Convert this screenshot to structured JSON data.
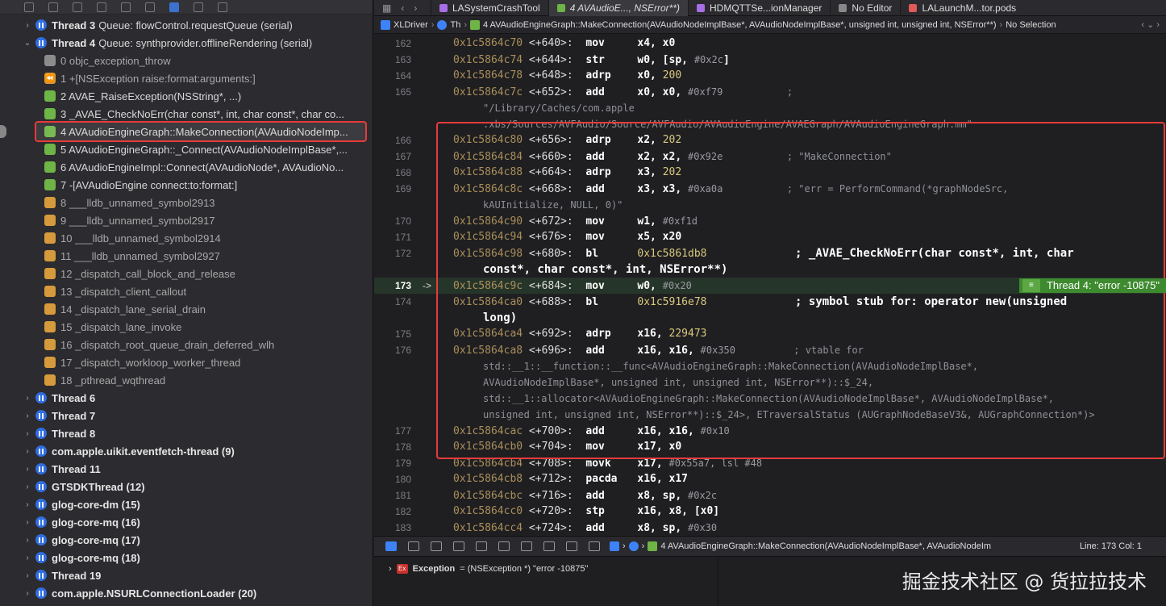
{
  "tabs": {
    "items": [
      {
        "label": "LASystemCrashTool",
        "color": "#a86ee6"
      },
      {
        "label": "4 AVAudioE..., NSError**)",
        "color": "#6eb446"
      },
      {
        "label": "HDMQTTSe...ionManager",
        "color": "#a86ee6"
      },
      {
        "label": "No Editor",
        "color": "#888888"
      },
      {
        "label": "LALaunchM...tor.pods",
        "color": "#e05a5a"
      }
    ]
  },
  "jumpbar": {
    "project": "XLDriver",
    "thread": "Th",
    "frame": "4 AVAudioEngineGraph::MakeConnection(AVAudioNodeImplBase*, AVAudioNodeImplBase*, unsigned int, unsigned int, NSError**)",
    "selection": "No Selection"
  },
  "threads": [
    {
      "type": "thread",
      "name": "Thread 3",
      "queue": "Queue: flowControl.requestQueue (serial)",
      "expanded": false
    },
    {
      "type": "thread",
      "name": "Thread 4",
      "queue": "Queue: synthprovider.offlineRendering (serial)",
      "expanded": true
    },
    {
      "type": "frame",
      "icon": "gray",
      "text": "0 objc_exception_throw",
      "dim": true
    },
    {
      "type": "frame",
      "icon": "orange",
      "text": "1 +[NSException raise:format:arguments:]",
      "dim": true
    },
    {
      "type": "frame",
      "icon": "green",
      "text": "2 AVAE_RaiseException(NSString*, ...)",
      "dim": false
    },
    {
      "type": "frame",
      "icon": "green",
      "text": "3 _AVAE_CheckNoErr(char const*, int, char const*, char co...",
      "dim": false
    },
    {
      "type": "frame",
      "icon": "green",
      "text": "4 AVAudioEngineGraph::MakeConnection(AVAudioNodeImp...",
      "dim": false,
      "selected": true
    },
    {
      "type": "frame",
      "icon": "green",
      "text": "5 AVAudioEngineGraph::_Connect(AVAudioNodeImplBase*,...",
      "dim": false
    },
    {
      "type": "frame",
      "icon": "green",
      "text": "6 AVAudioEngineImpl::Connect(AVAudioNode*, AVAudioNo...",
      "dim": false
    },
    {
      "type": "frame",
      "icon": "green",
      "text": "7 -[AVAudioEngine connect:to:format:]",
      "dim": false
    },
    {
      "type": "frame",
      "icon": "orange",
      "text": "8 ___lldb_unnamed_symbol2913",
      "dim": true
    },
    {
      "type": "frame",
      "icon": "orange",
      "text": "9 ___lldb_unnamed_symbol2917",
      "dim": true
    },
    {
      "type": "frame",
      "icon": "orange",
      "text": "10 ___lldb_unnamed_symbol2914",
      "dim": true
    },
    {
      "type": "frame",
      "icon": "orange",
      "text": "11 ___lldb_unnamed_symbol2927",
      "dim": true
    },
    {
      "type": "frame",
      "icon": "orange",
      "text": "12 _dispatch_call_block_and_release",
      "dim": true
    },
    {
      "type": "frame",
      "icon": "orange",
      "text": "13 _dispatch_client_callout",
      "dim": true
    },
    {
      "type": "frame",
      "icon": "orange",
      "text": "14 _dispatch_lane_serial_drain",
      "dim": true
    },
    {
      "type": "frame",
      "icon": "orange",
      "text": "15 _dispatch_lane_invoke",
      "dim": true
    },
    {
      "type": "frame",
      "icon": "orange",
      "text": "16 _dispatch_root_queue_drain_deferred_wlh",
      "dim": true
    },
    {
      "type": "frame",
      "icon": "orange",
      "text": "17 _dispatch_workloop_worker_thread",
      "dim": true
    },
    {
      "type": "frame",
      "icon": "orange",
      "text": "18 _pthread_wqthread",
      "dim": true
    },
    {
      "type": "thread",
      "name": "Thread 6",
      "queue": "",
      "expanded": false
    },
    {
      "type": "thread",
      "name": "Thread 7",
      "queue": "",
      "expanded": false
    },
    {
      "type": "thread",
      "name": "Thread 8",
      "queue": "",
      "expanded": false
    },
    {
      "type": "thread",
      "name": "com.apple.uikit.eventfetch-thread (9)",
      "queue": "",
      "expanded": false
    },
    {
      "type": "thread",
      "name": "Thread 11",
      "queue": "",
      "expanded": false
    },
    {
      "type": "thread",
      "name": "GTSDKThread (12)",
      "queue": "",
      "expanded": false
    },
    {
      "type": "thread",
      "name": "glog-core-dm (15)",
      "queue": "",
      "expanded": false
    },
    {
      "type": "thread",
      "name": "glog-core-mq (16)",
      "queue": "",
      "expanded": false
    },
    {
      "type": "thread",
      "name": "glog-core-mq (17)",
      "queue": "",
      "expanded": false
    },
    {
      "type": "thread",
      "name": "glog-core-mq (18)",
      "queue": "",
      "expanded": false
    },
    {
      "type": "thread",
      "name": "Thread 19",
      "queue": "",
      "expanded": false
    },
    {
      "type": "thread",
      "name": "com.apple.NSURLConnectionLoader (20)",
      "queue": "",
      "expanded": false
    }
  ],
  "code": [
    {
      "ln": "162",
      "addr": "0x1c5864c70",
      "off": "<+640>:",
      "mn": "mov",
      "ops": "x4, x0",
      "imm": "",
      "cm": ""
    },
    {
      "ln": "163",
      "addr": "0x1c5864c74",
      "off": "<+644>:",
      "mn": "str",
      "ops": "w0, [sp, ",
      "imm": "#0x2c",
      "tail": "]",
      "cm": ""
    },
    {
      "ln": "164",
      "addr": "0x1c5864c78",
      "off": "<+648>:",
      "mn": "adrp",
      "ops": "x0, ",
      "num": "200",
      "cm": ""
    },
    {
      "ln": "165",
      "addr": "0x1c5864c7c",
      "off": "<+652>:",
      "mn": "add",
      "ops": "x0, x0, ",
      "imm": "#0xf79",
      "cm": "           ;"
    },
    {
      "cont": "\"/Library/Caches/com.apple"
    },
    {
      "cont": ".xbs/Sources/AVFAudio/Source/AVFAudio/AVAudioEngine/AVAEGraph/AVAudioEngineGraph.mm\""
    },
    {
      "ln": "166",
      "addr": "0x1c5864c80",
      "off": "<+656>:",
      "mn": "adrp",
      "ops": "x2, ",
      "num": "202",
      "cm": ""
    },
    {
      "ln": "167",
      "addr": "0x1c5864c84",
      "off": "<+660>:",
      "mn": "add",
      "ops": "x2, x2, ",
      "imm": "#0x92e",
      "cm": "           ; \"MakeConnection\""
    },
    {
      "ln": "168",
      "addr": "0x1c5864c88",
      "off": "<+664>:",
      "mn": "adrp",
      "ops": "x3, ",
      "num": "202",
      "cm": ""
    },
    {
      "ln": "169",
      "addr": "0x1c5864c8c",
      "off": "<+668>:",
      "mn": "add",
      "ops": "x3, x3, ",
      "imm": "#0xa0a",
      "cm": "           ; \"err = PerformCommand(*graphNodeSrc,"
    },
    {
      "cont": "kAUInitialize, NULL, 0)\""
    },
    {
      "ln": "170",
      "addr": "0x1c5864c90",
      "off": "<+672>:",
      "mn": "mov",
      "ops": "w1, ",
      "imm": "#0xf1d",
      "cm": ""
    },
    {
      "ln": "171",
      "addr": "0x1c5864c94",
      "off": "<+676>:",
      "mn": "mov",
      "ops": "x5, x20",
      "cm": ""
    },
    {
      "ln": "172",
      "addr": "0x1c5864c98",
      "off": "<+680>:",
      "mn": "bl",
      "ops": "",
      "num": "0x1c5861db8",
      "cmb": "             ; _AVAE_CheckNoErr(char const*, int, char"
    },
    {
      "contb": "const*, char const*, int, NSError**)"
    },
    {
      "ln": "173",
      "addr": "0x1c5864c9c",
      "off": "<+684>:",
      "mn": "mov",
      "ops": "w0, ",
      "imm": "#0x20",
      "cm": "",
      "hl": true
    },
    {
      "ln": "174",
      "addr": "0x1c5864ca0",
      "off": "<+688>:",
      "mn": "bl",
      "ops": "",
      "num": "0x1c5916e78",
      "cmb": "             ; symbol stub for: operator new(unsigned"
    },
    {
      "contb": "long)"
    },
    {
      "ln": "175",
      "addr": "0x1c5864ca4",
      "off": "<+692>:",
      "mn": "adrp",
      "ops": "x16, ",
      "num": "229473",
      "cm": ""
    },
    {
      "ln": "176",
      "addr": "0x1c5864ca8",
      "off": "<+696>:",
      "mn": "add",
      "ops": "x16, x16, ",
      "imm": "#0x350",
      "cm": "          ; vtable for"
    },
    {
      "cont": "std::__1::__function::__func<AVAudioEngineGraph::MakeConnection(AVAudioNodeImplBase*,"
    },
    {
      "cont": "AVAudioNodeImplBase*, unsigned int, unsigned int, NSError**)::$_24,"
    },
    {
      "cont": "std::__1::allocator<AVAudioEngineGraph::MakeConnection(AVAudioNodeImplBase*, AVAudioNodeImplBase*,"
    },
    {
      "cont": "unsigned int, unsigned int, NSError**)::$_24>, ETraversalStatus (AUGraphNodeBaseV3&, AUGraphConnection*)>"
    },
    {
      "ln": "177",
      "addr": "0x1c5864cac",
      "off": "<+700>:",
      "mn": "add",
      "ops": "x16, x16, ",
      "imm": "#0x10",
      "cm": ""
    },
    {
      "ln": "178",
      "addr": "0x1c5864cb0",
      "off": "<+704>:",
      "mn": "mov",
      "ops": "x17, x0",
      "cm": ""
    },
    {
      "ln": "179",
      "addr": "0x1c5864cb4",
      "off": "<+708>:",
      "mn": "movk",
      "ops": "x17, ",
      "imm": "#0x55a7, lsl #48",
      "cm": ""
    },
    {
      "ln": "180",
      "addr": "0x1c5864cb8",
      "off": "<+712>:",
      "mn": "pacda",
      "ops": "x16, x17",
      "cm": ""
    },
    {
      "ln": "181",
      "addr": "0x1c5864cbc",
      "off": "<+716>:",
      "mn": "add",
      "ops": "x8, sp, ",
      "imm": "#0x2c",
      "cm": ""
    },
    {
      "ln": "182",
      "addr": "0x1c5864cc0",
      "off": "<+720>:",
      "mn": "stp",
      "ops": "x16, x8, [x0]",
      "cm": ""
    },
    {
      "ln": "183",
      "addr": "0x1c5864cc4",
      "off": "<+724>:",
      "mn": "add",
      "ops": "x8, sp, ",
      "imm": "#0x30",
      "cm": ""
    }
  ],
  "current_line": {
    "arrow": "->",
    "badge": "Thread 4: \"error -10875\""
  },
  "debugbar": {
    "frame": "4 AVAudioEngineGraph::MakeConnection(AVAudioNodeImplBase*, AVAudioNodeIm",
    "position": "Line: 173  Col: 1"
  },
  "console": {
    "var_name": "Exception",
    "var_value": "= (NSException *) \"error -10875\"",
    "badge": "Ex",
    "watermark": "掘金技术社区 @ 货拉拉技术"
  }
}
